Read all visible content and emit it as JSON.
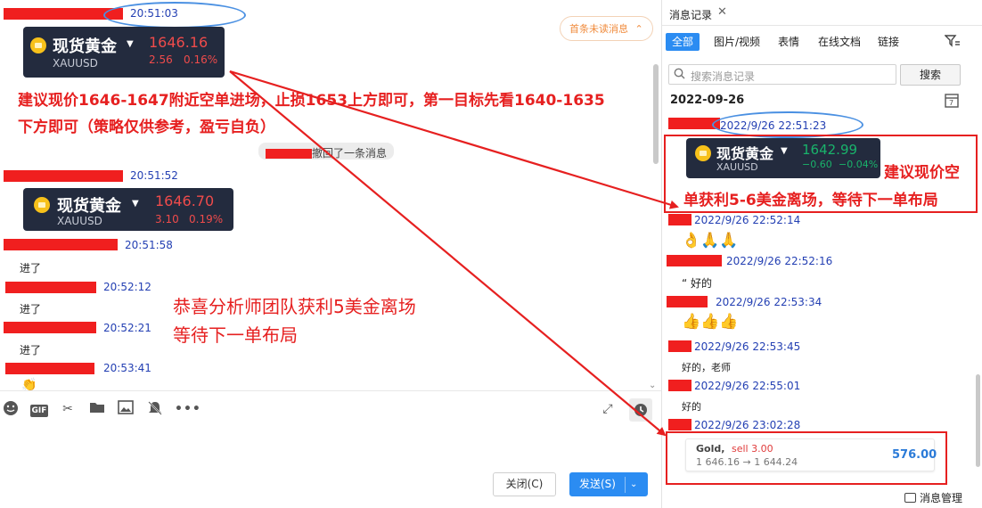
{
  "chat": {
    "messages": [
      {
        "time": "20:51:03"
      },
      {
        "time": "20:51:52"
      },
      {
        "time": "20:51:58",
        "text": "进了"
      },
      {
        "time": "20:52:12",
        "text": "进了"
      },
      {
        "time": "20:52:21",
        "text": "进了"
      },
      {
        "time": "20:53:41"
      }
    ],
    "card1": {
      "name": "现货黄金",
      "symbol": "XAUUSD",
      "price": "1646.16",
      "change": "2.56",
      "percent": "0.16%"
    },
    "card2": {
      "name": "现货黄金",
      "symbol": "XAUUSD",
      "price": "1646.70",
      "change": "3.10",
      "percent": "0.19%"
    },
    "annotation_line1": "建议现价1646-1647附近空单进场，止损1653上方即可，第一目标先看1640-1635",
    "annotation_line2": "下方即可（策略仅供参考，盈亏自负）",
    "system_note": "撤回了一条消息",
    "unread_pill": "首条未读消息",
    "congrats_line1": "恭喜分析师团队获利5美金离场",
    "congrats_line2": "等待下一单布局"
  },
  "toolbar": {
    "icons": [
      "emoji-icon",
      "gif-icon",
      "scissors-icon",
      "folder-icon",
      "image-icon",
      "bell-off-icon",
      "more-icon"
    ],
    "gif_label": "GIF"
  },
  "input": {
    "close_label": "关闭(C)",
    "send_label": "发送(S)"
  },
  "panel": {
    "title": "消息记录",
    "tabs": [
      "全部",
      "图片/视频",
      "表情",
      "在线文档",
      "链接"
    ],
    "search_placeholder": "搜索消息记录",
    "search_button": "搜索",
    "date": "2022-09-26",
    "entries": [
      {
        "time": "2022/9/26 22:51:23"
      },
      {
        "time": "2022/9/26 22:52:14",
        "text": "👌🙏🙏"
      },
      {
        "time": "2022/9/26 22:52:16",
        "text": "“ 好的"
      },
      {
        "time": "2022/9/26 22:53:34",
        "text": "👍👍👍"
      },
      {
        "time": "2022/9/26 22:53:45",
        "text": "好的，老师"
      },
      {
        "time": "2022/9/26 22:55:01",
        "text": "好的"
      },
      {
        "time": "2022/9/26 23:02:28"
      }
    ],
    "card": {
      "name": "现货黄金",
      "symbol": "XAUUSD",
      "price": "1642.99",
      "change": "−0.60",
      "percent": "−0.04%"
    },
    "annotation_line1": "建议现价空",
    "annotation_line2": "单获利5-6美金离场，等待下一单布局",
    "trade": {
      "instrument": "Gold,",
      "side": "sell 3.00",
      "prices": "1 646.16 → 1 644.24",
      "profit": "576.00"
    },
    "manage_label": "消息管理"
  },
  "colors": {
    "accent": "#2b8cf2",
    "annotation": "#e62020",
    "timestamp": "#2440b3",
    "card_bg": "#232b3e",
    "up": "#ef4b4b",
    "down": "#19b36b"
  }
}
